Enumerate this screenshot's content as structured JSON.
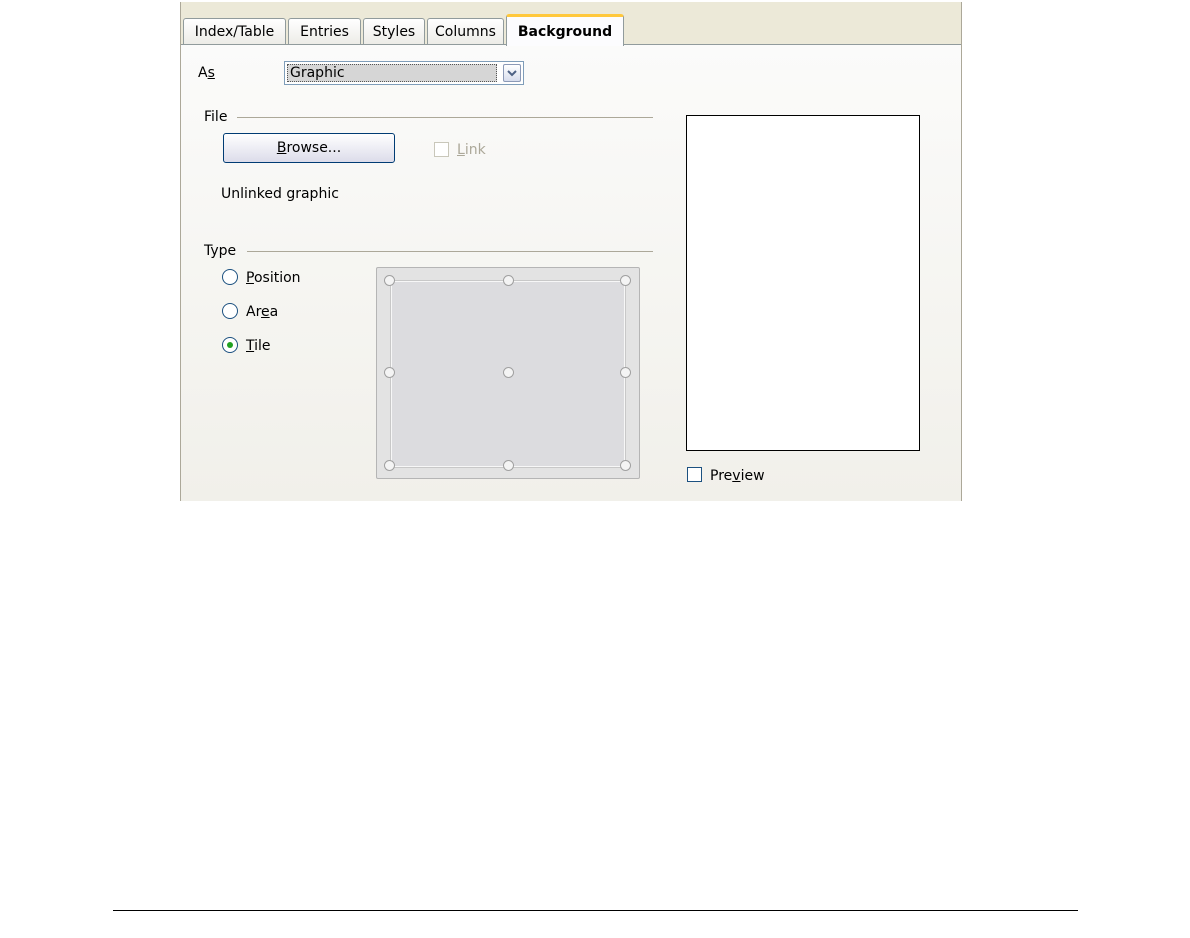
{
  "tabs": [
    {
      "label": "Index/Table"
    },
    {
      "label": "Entries"
    },
    {
      "label": "Styles"
    },
    {
      "label": "Columns"
    },
    {
      "label": "Background",
      "active": true
    }
  ],
  "as_row": {
    "label_pre": "A",
    "label_mnemonic": "s",
    "selected": "Graphic"
  },
  "file_section": {
    "title": "File",
    "browse_pre": "",
    "browse_mnemonic": "B",
    "browse_post": "rowse...",
    "link_pre": "",
    "link_mnemonic": "L",
    "link_post": "ink",
    "link_checked": false,
    "link_disabled": true,
    "status": "Unlinked graphic"
  },
  "type_section": {
    "title": "Type",
    "options": [
      {
        "pre": "",
        "mnemonic": "P",
        "post": "osition",
        "selected": false
      },
      {
        "pre": "Ar",
        "mnemonic": "e",
        "post": "a",
        "selected": false
      },
      {
        "pre": "",
        "mnemonic": "T",
        "post": "ile",
        "selected": true
      }
    ]
  },
  "preview": {
    "pre": "Pre",
    "mnemonic": "v",
    "post": "iew",
    "checked": false
  },
  "colors": {
    "active_tab_accent": "#ffc83c",
    "radio_dot": "#21a121",
    "button_border": "#003c74"
  }
}
